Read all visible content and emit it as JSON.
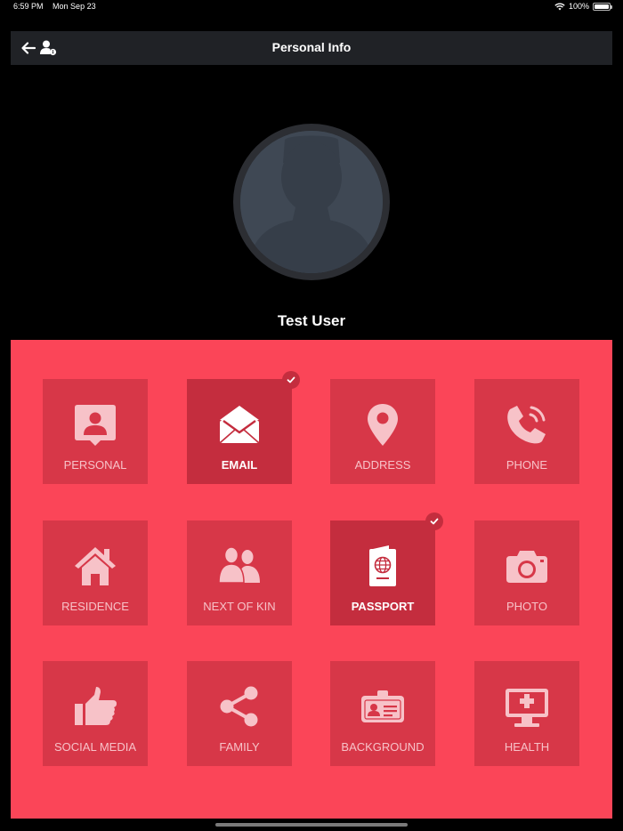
{
  "status_bar": {
    "time": "6:59 PM",
    "date": "Mon Sep 23",
    "battery": "100%"
  },
  "nav": {
    "title": "Personal Info",
    "back_icon": "arrow-left-icon",
    "user_icon": "user-info-icon"
  },
  "profile": {
    "name": "Test User",
    "avatar_icon": "person-silhouette-icon"
  },
  "colors": {
    "panel": "#fb4558",
    "tile": "#d73748",
    "tile_selected": "#c42d3e",
    "nav": "#202226"
  },
  "tiles": [
    {
      "label": "PERSONAL",
      "icon": "contact-card-icon",
      "selected": false
    },
    {
      "label": "EMAIL",
      "icon": "envelope-open-icon",
      "selected": true
    },
    {
      "label": "ADDRESS",
      "icon": "map-pin-icon",
      "selected": false
    },
    {
      "label": "PHONE",
      "icon": "phone-ringing-icon",
      "selected": false
    },
    {
      "label": "RESIDENCE",
      "icon": "house-icon",
      "selected": false
    },
    {
      "label": "NEXT OF KIN",
      "icon": "people-icon",
      "selected": false
    },
    {
      "label": "PASSPORT",
      "icon": "passport-icon",
      "selected": true
    },
    {
      "label": "PHOTO",
      "icon": "camera-icon",
      "selected": false
    },
    {
      "label": "SOCIAL MEDIA",
      "icon": "thumbs-up-icon",
      "selected": false
    },
    {
      "label": "FAMILY",
      "icon": "share-icon",
      "selected": false
    },
    {
      "label": "BACKGROUND",
      "icon": "id-badge-icon",
      "selected": false
    },
    {
      "label": "HEALTH",
      "icon": "medical-monitor-icon",
      "selected": false
    }
  ]
}
